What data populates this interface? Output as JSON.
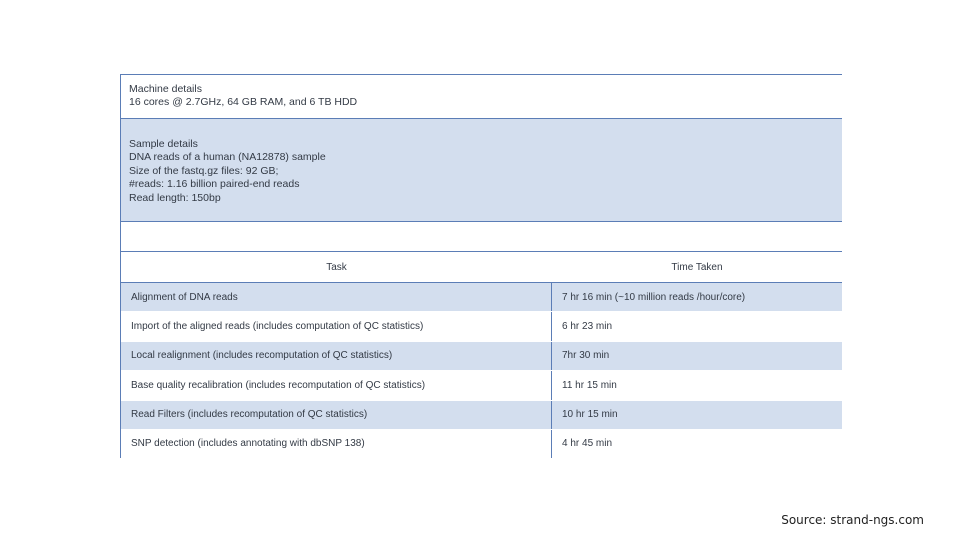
{
  "machine": {
    "heading": "Machine details",
    "spec": "16 cores @ 2.7GHz, 64 GB RAM, and 6 TB HDD"
  },
  "sample": {
    "heading": "Sample details",
    "lines": [
      "DNA reads of a human (NA12878) sample",
      "Size of the fastq.gz files: 92 GB;",
      "#reads: 1.16 billion paired-end reads",
      "Read length: 150bp"
    ]
  },
  "table": {
    "headers": [
      "Task",
      "Time Taken"
    ],
    "rows": [
      {
        "task": "Alignment of DNA reads",
        "time": "7 hr 16 min (~10 million reads /hour/core)"
      },
      {
        "task": "Import of the aligned reads (includes computation of QC statistics)",
        "time": "6 hr 23 min"
      },
      {
        "task": "Local realignment (includes recomputation of QC statistics)",
        "time": "7hr 30 min"
      },
      {
        "task": "Base quality recalibration (includes recomputation of QC statistics)",
        "time": "11 hr 15 min"
      },
      {
        "task": "Read Filters (includes recomputation of QC statistics)",
        "time": "10 hr 15 min"
      },
      {
        "task": "SNP detection (includes annotating with dbSNP 138)",
        "time": "4 hr 45 min"
      }
    ]
  },
  "footer": {
    "source": "Source: strand-ngs.com"
  },
  "colors": {
    "accent_border": "#5b7db6",
    "row_fill": "#d3deee"
  }
}
